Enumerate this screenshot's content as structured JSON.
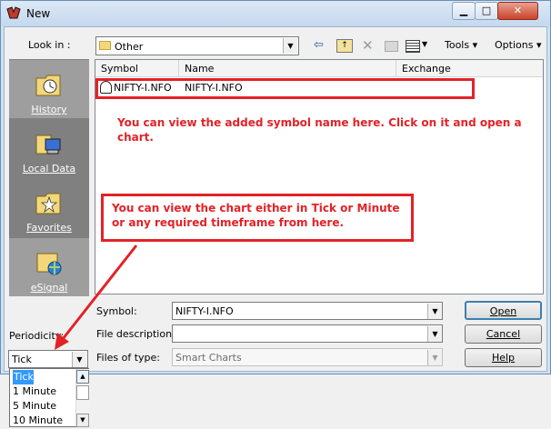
{
  "window": {
    "title": "New",
    "min_glyph": "▁",
    "max_glyph": "□",
    "close_glyph": "✕"
  },
  "toolbar": {
    "look_in_label": "Look in :",
    "look_in_value": "Other",
    "tools_label": "Tools ▾",
    "options_label": "Options ▾",
    "back_glyph": "⇦",
    "up_glyph": "↑",
    "delete_glyph": "✕",
    "view_arrow": "▼"
  },
  "places": [
    {
      "label": "History"
    },
    {
      "label": "Local Data"
    },
    {
      "label": "Favorites"
    },
    {
      "label": "eSignal"
    }
  ],
  "filelist": {
    "columns": [
      "Symbol",
      "Name",
      "Exchange"
    ],
    "rows": [
      {
        "symbol": "NIFTY-I.NFO",
        "name": "NIFTY-I.NFO",
        "exchange": ""
      }
    ]
  },
  "annotations": {
    "note1": "You can view the added symbol name here. Click on it and open a chart.",
    "note2": "You can view the chart either in Tick or Minute or any required timeframe from here.",
    "color": "#e32227"
  },
  "form": {
    "symbol_label": "Symbol:",
    "symbol_value": "NIFTY-I.NFO",
    "file_desc_label": "File description:",
    "file_desc_value": "",
    "file_type_label": "Files of type:",
    "file_type_value": "Smart Charts",
    "arrow": "▼"
  },
  "buttons": {
    "open": "Open",
    "cancel": "Cancel",
    "help": "Help"
  },
  "periodicity": {
    "label": "Periodicity:",
    "selected": "Tick",
    "options": [
      "Tick",
      "1 Minute",
      "5 Minute",
      "10 Minute"
    ],
    "scroll_up": "▲",
    "scroll_down": "▼"
  }
}
